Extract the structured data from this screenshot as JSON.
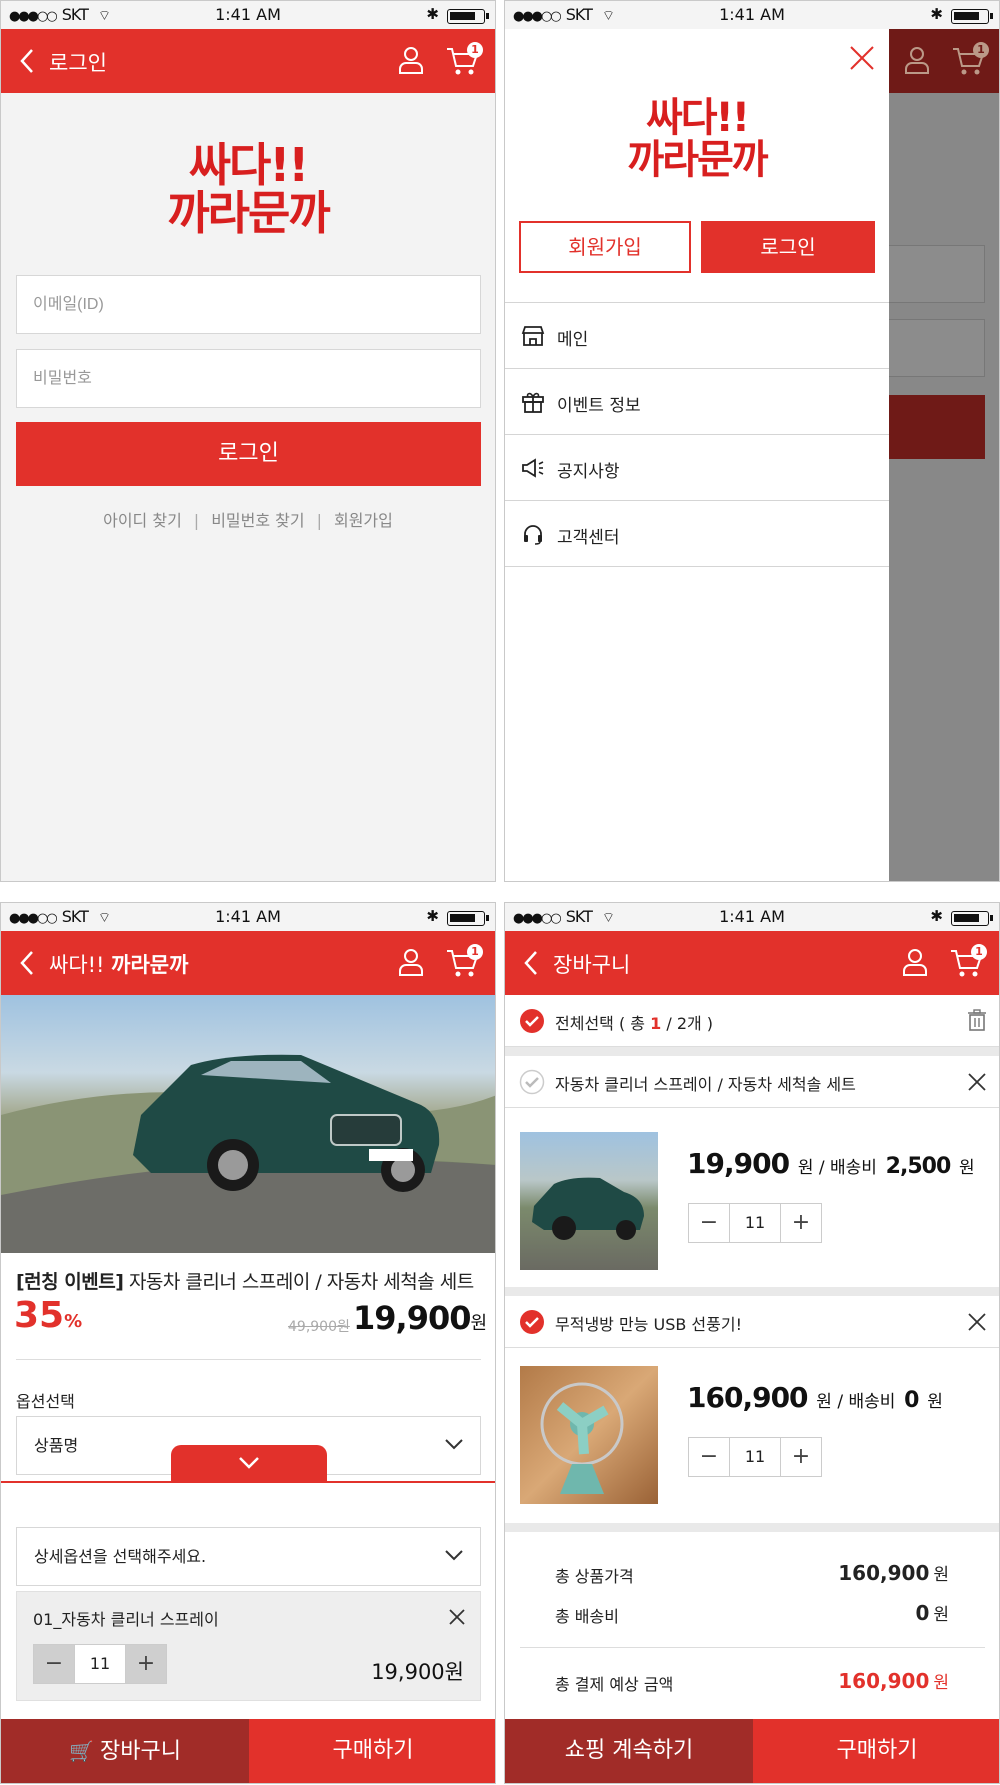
{
  "status": {
    "carrier": "SKT",
    "time": "1:41 AM"
  },
  "screen_login": {
    "header_title": "로그인",
    "cart_badge": "1",
    "logo_line1": "싸다!!",
    "logo_line2": "까라문까",
    "email_placeholder": "이메일(ID)",
    "password_placeholder": "비밀번호",
    "login_button": "로그인",
    "links": [
      "아이디 찾기",
      "비밀번호 찾기",
      "회원가입"
    ],
    "link_separator": "|"
  },
  "screen_menu": {
    "cart_badge": "1",
    "logo_line1": "싸다!!",
    "logo_line2": "까라문까",
    "signup_button": "회원가입",
    "login_button": "로그인",
    "menu_items": [
      {
        "label": "메인",
        "icon": "store-icon"
      },
      {
        "label": "이벤트 정보",
        "icon": "gift-icon"
      },
      {
        "label": "공지사항",
        "icon": "megaphone-icon"
      },
      {
        "label": "고객센터",
        "icon": "headset-icon"
      }
    ]
  },
  "screen_product": {
    "header_title_light": "싸다!!",
    "header_title_bold": "까라문까",
    "cart_badge": "1",
    "product_tag": "[런칭 이벤트]",
    "product_name": "자동차 클리너 스프레이 / 자동차 세척솔 세트",
    "discount_value": "35",
    "discount_unit": "%",
    "original_price": "49,900원",
    "sale_price": "19,900",
    "sale_price_unit": "원",
    "option_label": "옵션선택",
    "option_select_value": "상품명",
    "detail_option_placeholder": "상세옵션을 선택해주세요.",
    "selected_option_name": "01_자동차 클리너 스프레이",
    "selected_option_qty": "11",
    "selected_option_price": "19,900원",
    "stepper_minus": "−",
    "stepper_plus": "+",
    "cart_button": "장바구니",
    "buy_button": "구매하기"
  },
  "screen_cart": {
    "header_title": "장바구니",
    "cart_badge": "1",
    "select_all_label": "전체선택 ( 총 ",
    "select_all_count": "1",
    "select_all_total": " / 2개 )",
    "items": [
      {
        "name": "자동차 클리너 스프레이 / 자동차 세척솔 세트",
        "checked": false,
        "price": "19,900",
        "price_unit": "원 / 배송비",
        "shipping": "2,500",
        "shipping_unit": "원",
        "qty": "11"
      },
      {
        "name": "무적냉방 만능 USB 선풍기!",
        "checked": true,
        "price": "160,900",
        "price_unit": "원 / 배송비",
        "shipping": "0",
        "shipping_unit": "원",
        "qty": "11"
      }
    ],
    "summary": {
      "product_total_label": "총 상품가격",
      "product_total": "160,900",
      "product_total_unit": "원",
      "shipping_label": "총 배송비",
      "shipping": "0",
      "shipping_unit": "원",
      "grand_total_label": "총 결제 예상 금액",
      "grand_total": "160,900",
      "grand_total_unit": "원"
    },
    "continue_button": "쇼핑 계속하기",
    "buy_button": "구매하기"
  },
  "colors": {
    "brand_red": "#e2312b",
    "dark_red": "#a12c28",
    "logo_red": "#d81f1f"
  }
}
